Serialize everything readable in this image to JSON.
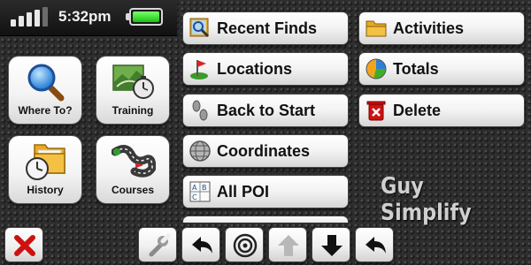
{
  "status": {
    "time": "5:32pm",
    "signal_bars": 4,
    "signal_bars_total": 5,
    "battery_level": 1.0,
    "battery_color": "#22cc11"
  },
  "tiles": [
    {
      "label": "Where To?",
      "icon": "magnifier-icon"
    },
    {
      "label": "Training",
      "icon": "training-map-stopwatch-icon"
    },
    {
      "label": "History",
      "icon": "history-folder-clock-icon"
    },
    {
      "label": "Courses",
      "icon": "courses-road-flag-icon"
    }
  ],
  "menu_middle": [
    {
      "label": "Recent Finds",
      "icon": "recent-finds-icon"
    },
    {
      "label": "Locations",
      "icon": "location-flag-icon"
    },
    {
      "label": "Back to Start",
      "icon": "footprints-icon"
    },
    {
      "label": "Coordinates",
      "icon": "globe-icon"
    },
    {
      "label": "All POI",
      "icon": "poi-abc-icon"
    }
  ],
  "menu_right": [
    {
      "label": "Activities",
      "icon": "folder-icon"
    },
    {
      "label": "Totals",
      "icon": "pie-chart-icon"
    },
    {
      "label": "Delete",
      "icon": "trash-x-icon"
    }
  ],
  "toolbar": [
    {
      "icon": "close-icon"
    },
    {
      "icon": "wrench-icon"
    },
    {
      "icon": "back-arrow-icon"
    },
    {
      "icon": "target-icon"
    },
    {
      "icon": "scroll-up-icon"
    },
    {
      "icon": "scroll-down-icon"
    },
    {
      "icon": "back-arrow-icon"
    }
  ],
  "watermark": "Guy Simplify",
  "colors": {
    "close_red": "#cc1111",
    "trash_red": "#cc1111",
    "disabled_arrow": "#b8b8b8"
  }
}
